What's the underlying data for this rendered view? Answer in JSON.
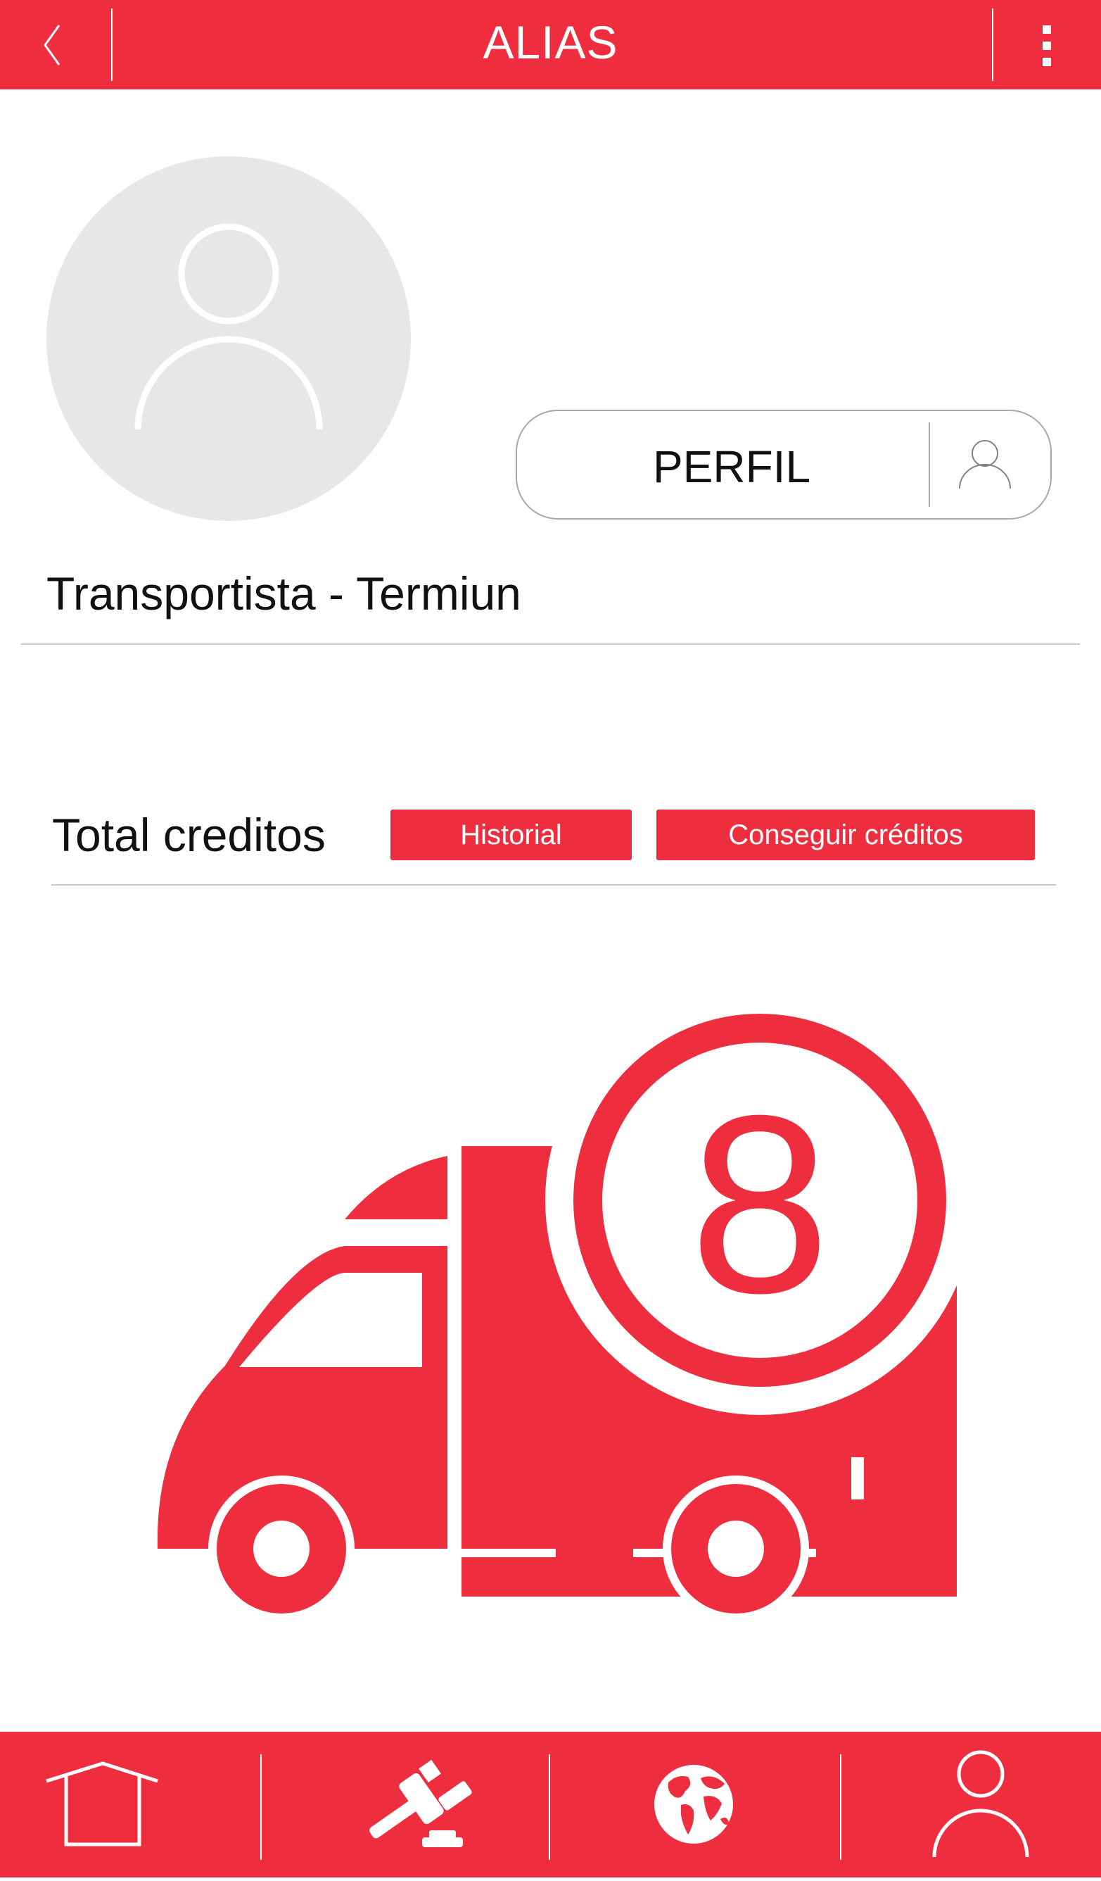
{
  "header": {
    "title": "ALIAS",
    "back_icon": "chevron-left-icon",
    "menu_icon": "kebab-menu-icon"
  },
  "profile": {
    "avatar_icon": "user-placeholder-icon",
    "perfil_button_label": "PERFIL",
    "perfil_button_icon": "user-icon",
    "role_text": "Transportista - Termiun"
  },
  "credits": {
    "label": "Total creditos",
    "historial_label": "Historial",
    "conseguir_label": "Conseguir créditos",
    "count": "8"
  },
  "bottom_nav": {
    "items": [
      {
        "icon": "home-icon"
      },
      {
        "icon": "auction-gavel-icon"
      },
      {
        "icon": "globe-icon"
      },
      {
        "icon": "user-icon"
      }
    ]
  },
  "colors": {
    "brand": "#ee2e3e",
    "avatar_bg": "#e6e7e8",
    "divider": "#c8c9cb"
  }
}
